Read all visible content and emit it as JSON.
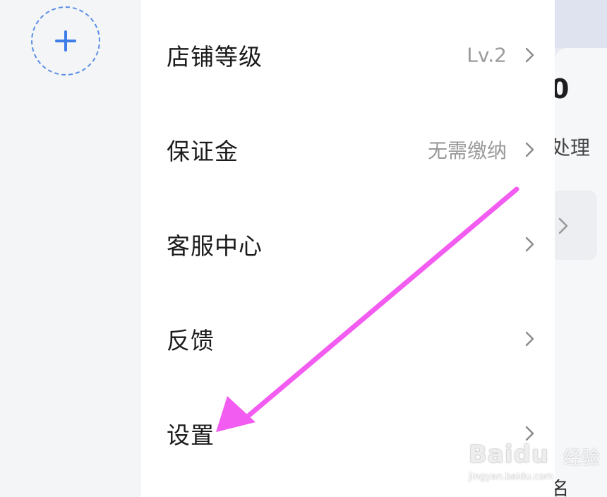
{
  "menu": {
    "items": [
      {
        "label": "店铺等级",
        "value": "Lv.2"
      },
      {
        "label": "保证金",
        "value": "无需缴纳"
      },
      {
        "label": "客服中心",
        "value": ""
      },
      {
        "label": "反馈",
        "value": ""
      },
      {
        "label": "设置",
        "value": ""
      }
    ]
  },
  "background_page": {
    "number_fragment": "0",
    "text_fragment": "处理",
    "bottom_fragment": "名"
  },
  "watermark": {
    "brand": "Baidu",
    "sub": "经验",
    "url": "jingyan.baidu.com"
  },
  "colors": {
    "accent_blue": "#3f7ee8",
    "annotation_magenta": "#f25cf0",
    "menu_text": "#1b1b1b",
    "value_text": "#9a9a9a"
  },
  "icons": {
    "add": "plus-icon",
    "row_arrow": "chevron-right-icon",
    "annotation": "arrow-annotation-icon"
  }
}
